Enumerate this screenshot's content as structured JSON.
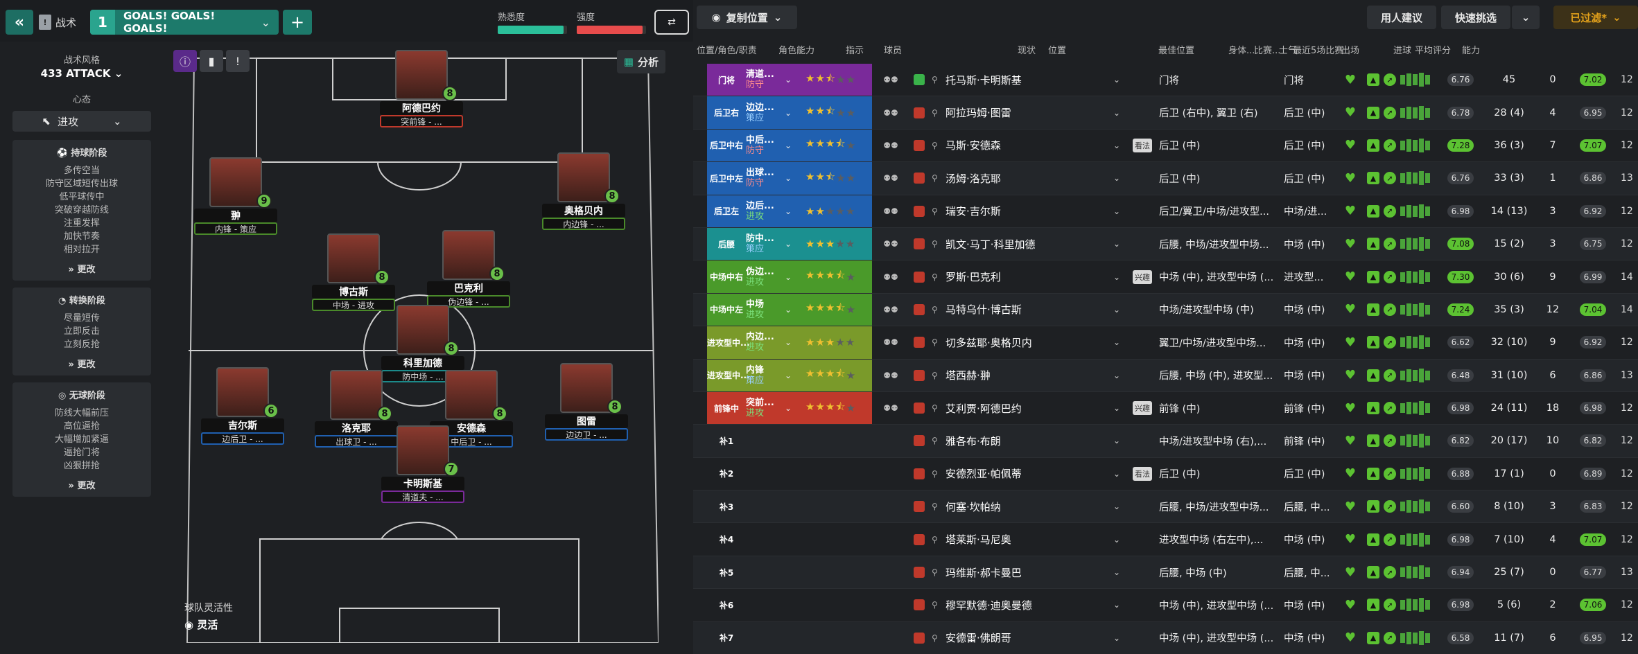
{
  "topbar": {
    "tactic_label": "战术",
    "tactic_num": "1",
    "tactic_name": "GOALS! GOALS! GOALS!",
    "familiarity_label": "熟悉度",
    "familiarity_value": 0.95,
    "intensity_label": "强度",
    "intensity_value": 0.95
  },
  "left": {
    "style_label": "战术风格",
    "style_value": "433 ATTACK",
    "mentality_label": "心态",
    "mentality_value": "进攻",
    "in_possession_title": "持球阶段",
    "in_possession": [
      "多传空当",
      "防守区域短传出球",
      "低平球传中",
      "突破穿越防线",
      "注重发挥",
      "加快节奏",
      "相对拉开"
    ],
    "transition_title": "转换阶段",
    "transition": [
      "尽量短传",
      "立即反击",
      "立刻反抢"
    ],
    "out_possession_title": "无球阶段",
    "out_possession": [
      "防线大幅前压",
      "高位逼抢",
      "大幅增加紧逼",
      "逼抢门将",
      "凶狠拼抢"
    ],
    "change_label": "更改"
  },
  "pitch": {
    "analysis_label": "分析",
    "agility_label": "球队灵活性",
    "agility_value": "灵活",
    "players": [
      {
        "name": "阿德巴约",
        "role": "突前锋 - ...",
        "rating": "8",
        "role_color": "#c0392b"
      },
      {
        "name": "翀",
        "role": "内锋 - 策应",
        "rating": "9",
        "role_color": "#4a8a2a"
      },
      {
        "name": "奥格贝内",
        "role": "内边锋 - ...",
        "rating": "8",
        "role_color": "#4a8a2a"
      },
      {
        "name": "博古斯",
        "role": "中场 - 进攻",
        "rating": "8",
        "role_color": "#4a8a2a"
      },
      {
        "name": "巴克利",
        "role": "伪边锋 - ...",
        "rating": "8",
        "role_color": "#4a8a2a"
      },
      {
        "name": "科里加德",
        "role": "防中场 - ...",
        "rating": "8",
        "role_color": "#1b8a8a"
      },
      {
        "name": "吉尔斯",
        "role": "边后卫 - ...",
        "rating": "6",
        "role_color": "#2060b0"
      },
      {
        "name": "洛克耶",
        "role": "出球卫 - ...",
        "rating": "8",
        "role_color": "#2060b0"
      },
      {
        "name": "安德森",
        "role": "中后卫 - ...",
        "rating": "8",
        "role_color": "#2060b0"
      },
      {
        "name": "图雷",
        "role": "边边卫 - ...",
        "rating": "8",
        "role_color": "#2060b0"
      },
      {
        "name": "卡明斯基",
        "role": "清道夫 - ...",
        "rating": "7",
        "role_color": "#7a2a9a"
      }
    ]
  },
  "rtop": {
    "copy_label": "复制位置",
    "suggest_label": "用人建议",
    "quick_label": "快速挑选",
    "filter_label": "已过滤*"
  },
  "table": {
    "headers": [
      "位置/角色/职责",
      "角色能力",
      "指示",
      "球员",
      "现状",
      "位置",
      "最佳位置",
      "身体...",
      "比赛...",
      "士气",
      "最近5场比赛",
      "出场",
      "进球",
      "平均评分",
      "能力"
    ],
    "rows": [
      {
        "code": "门将",
        "role": "清道...",
        "duty": "防守",
        "duty_color": "#ff8c8c",
        "code_bg": "#7a2a9a",
        "stars": 2.5,
        "name": "托马斯·卡明斯基",
        "status": "",
        "position": "门将",
        "best": "门将",
        "avg": "6.76",
        "avg_green": false,
        "apps": "45",
        "goals": "0",
        "rating": "7.02",
        "rating_green": true,
        "last": "12"
      },
      {
        "code": "后卫右",
        "role": "边边...",
        "duty": "策应",
        "duty_color": "#9ad0ff",
        "code_bg": "#2060b0",
        "stars": 2.5,
        "name": "阿拉玛姆·图雷",
        "status": "",
        "position": "后卫 (右中), 翼卫 (右)",
        "best": "后卫 (中)",
        "avg": "6.78",
        "avg_green": false,
        "apps": "28 (4)",
        "goals": "4",
        "rating": "6.95",
        "rating_green": false,
        "last": "12"
      },
      {
        "code": "后卫中右",
        "role": "中后...",
        "duty": "防守",
        "duty_color": "#ff8c8c",
        "code_bg": "#2060b0",
        "stars": 3.5,
        "name": "马斯·安德森",
        "status": "看法",
        "position": "后卫 (中)",
        "best": "后卫 (中)",
        "avg": "7.28",
        "avg_green": true,
        "apps": "36 (3)",
        "goals": "7",
        "rating": "7.07",
        "rating_green": true,
        "last": "12"
      },
      {
        "code": "后卫中左",
        "role": "出球...",
        "duty": "防守",
        "duty_color": "#ff8c8c",
        "code_bg": "#2060b0",
        "stars": 2.5,
        "name": "汤姆·洛克耶",
        "status": "",
        "position": "后卫 (中)",
        "best": "后卫 (中)",
        "avg": "6.76",
        "avg_green": false,
        "apps": "33 (3)",
        "goals": "1",
        "rating": "6.86",
        "rating_green": false,
        "last": "13"
      },
      {
        "code": "后卫左",
        "role": "边后...",
        "duty": "进攻",
        "duty_color": "#7be07b",
        "code_bg": "#2060b0",
        "stars": 2,
        "name": "瑞安·吉尔斯",
        "status": "",
        "position": "后卫/翼卫/中场/进攻型...",
        "best": "中场/进...",
        "avg": "6.98",
        "avg_green": false,
        "apps": "14 (13)",
        "goals": "3",
        "rating": "6.92",
        "rating_green": false,
        "last": "12"
      },
      {
        "code": "后腰",
        "role": "防中...",
        "duty": "策应",
        "duty_color": "#9ad0ff",
        "code_bg": "#1b9090",
        "stars": 3,
        "name": "凯文·马丁·科里加德",
        "status": "",
        "position": "后腰, 中场/进攻型中场...",
        "best": "中场 (中)",
        "avg": "7.08",
        "avg_green": true,
        "apps": "15 (2)",
        "goals": "3",
        "rating": "6.75",
        "rating_green": false,
        "last": "12"
      },
      {
        "code": "中场中右",
        "role": "伪边...",
        "duty": "进攻",
        "duty_color": "#7be07b",
        "code_bg": "#4a9a2a",
        "stars": 3.5,
        "name": "罗斯·巴克利",
        "status": "兴趣",
        "position": "中场 (中), 进攻型中场 (...",
        "best": "进攻型...",
        "avg": "7.30",
        "avg_green": true,
        "apps": "30 (6)",
        "goals": "9",
        "rating": "6.99",
        "rating_green": false,
        "last": "14"
      },
      {
        "code": "中场中左",
        "role": "中场",
        "duty": "进攻",
        "duty_color": "#7be07b",
        "code_bg": "#4a9a2a",
        "stars": 3.5,
        "name": "马特乌什·博古斯",
        "status": "",
        "position": "中场/进攻型中场 (中)",
        "best": "中场 (中)",
        "avg": "7.24",
        "avg_green": true,
        "apps": "35 (3)",
        "goals": "12",
        "rating": "7.04",
        "rating_green": true,
        "last": "14"
      },
      {
        "code": "进攻型中...",
        "role": "内边...",
        "duty": "进攻",
        "duty_color": "#7be07b",
        "code_bg": "#7a9a2a",
        "stars": 3,
        "name": "切多兹耶·奥格贝内",
        "status": "",
        "position": "翼卫/中场/进攻型中场...",
        "best": "中场 (中)",
        "avg": "6.62",
        "avg_green": false,
        "apps": "32 (10)",
        "goals": "9",
        "rating": "6.92",
        "rating_green": false,
        "last": "12"
      },
      {
        "code": "进攻型中...",
        "role": "内锋",
        "duty": "策应",
        "duty_color": "#9ad0ff",
        "code_bg": "#7a9a2a",
        "stars": 3.5,
        "name": "塔西赫·翀",
        "status": "",
        "position": "后腰, 中场 (中), 进攻型...",
        "best": "中场 (中)",
        "avg": "6.48",
        "avg_green": false,
        "apps": "31 (10)",
        "goals": "6",
        "rating": "6.86",
        "rating_green": false,
        "last": "13"
      },
      {
        "code": "前锋中",
        "role": "突前...",
        "duty": "进攻",
        "duty_color": "#7be07b",
        "code_bg": "#c0392b",
        "stars": 3.5,
        "name": "艾利贾·阿德巴约",
        "status": "兴趣",
        "position": "前锋 (中)",
        "best": "前锋 (中)",
        "avg": "6.98",
        "avg_green": false,
        "apps": "24 (11)",
        "goals": "18",
        "rating": "6.98",
        "rating_green": false,
        "last": "12"
      },
      {
        "code": "补1",
        "role": "",
        "duty": "",
        "duty_color": "#fff",
        "code_bg": "",
        "stars": 0,
        "name": "雅各布·布朗",
        "status": "",
        "position": "中场/进攻型中场 (右),...",
        "best": "前锋 (中)",
        "avg": "6.82",
        "avg_green": false,
        "apps": "20 (17)",
        "goals": "10",
        "rating": "6.82",
        "rating_green": false,
        "last": "12"
      },
      {
        "code": "补2",
        "role": "",
        "duty": "",
        "duty_color": "#fff",
        "code_bg": "",
        "stars": 0,
        "name": "安德烈亚·帕佩蒂",
        "status": "看法",
        "position": "后卫 (中)",
        "best": "后卫 (中)",
        "avg": "6.88",
        "avg_green": false,
        "apps": "17 (1)",
        "goals": "0",
        "rating": "6.89",
        "rating_green": false,
        "last": "12"
      },
      {
        "code": "补3",
        "role": "",
        "duty": "",
        "duty_color": "#fff",
        "code_bg": "",
        "stars": 0,
        "name": "何塞·坎帕纳",
        "status": "",
        "position": "后腰, 中场/进攻型中场...",
        "best": "后腰, 中...",
        "avg": "6.60",
        "avg_green": false,
        "apps": "8 (10)",
        "goals": "3",
        "rating": "6.83",
        "rating_green": false,
        "last": "12"
      },
      {
        "code": "补4",
        "role": "",
        "duty": "",
        "duty_color": "#fff",
        "code_bg": "",
        "stars": 0,
        "name": "塔莱斯·马尼奥",
        "status": "",
        "position": "进攻型中场 (右左中),...",
        "best": "中场 (中)",
        "avg": "6.98",
        "avg_green": false,
        "apps": "7 (10)",
        "goals": "4",
        "rating": "7.07",
        "rating_green": true,
        "last": "12"
      },
      {
        "code": "补5",
        "role": "",
        "duty": "",
        "duty_color": "#fff",
        "code_bg": "",
        "stars": 0,
        "name": "玛维斯·郝卡曼巴",
        "status": "",
        "position": "后腰, 中场 (中)",
        "best": "后腰, 中...",
        "avg": "6.94",
        "avg_green": false,
        "apps": "25 (7)",
        "goals": "0",
        "rating": "6.77",
        "rating_green": false,
        "last": "13"
      },
      {
        "code": "补6",
        "role": "",
        "duty": "",
        "duty_color": "#fff",
        "code_bg": "",
        "stars": 0,
        "name": "穆罕默德·迪奥曼德",
        "status": "",
        "position": "中场 (中), 进攻型中场 (...",
        "best": "中场 (中)",
        "avg": "6.98",
        "avg_green": false,
        "apps": "5 (6)",
        "goals": "2",
        "rating": "7.06",
        "rating_green": true,
        "last": "12"
      },
      {
        "code": "补7",
        "role": "",
        "duty": "",
        "duty_color": "#fff",
        "code_bg": "",
        "stars": 0,
        "name": "安德雷·佛朗哥",
        "status": "",
        "position": "中场 (中), 进攻型中场 (...",
        "best": "中场 (中)",
        "avg": "6.58",
        "avg_green": false,
        "apps": "11 (7)",
        "goals": "6",
        "rating": "6.95",
        "rating_green": false,
        "last": "12"
      }
    ]
  }
}
